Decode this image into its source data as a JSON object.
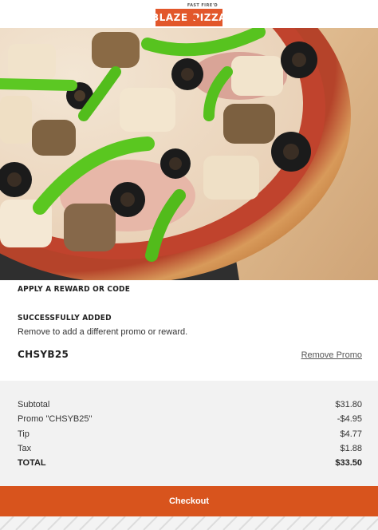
{
  "header": {
    "logo_tagline": "FAST FIRE'D",
    "logo_left": "BLAZE",
    "logo_right": "PIZZA"
  },
  "promo": {
    "heading": "APPLY A REWARD OR CODE",
    "status_heading": "SUCCESSFULLY ADDED",
    "status_body": "Remove to add a different promo or reward.",
    "code": "CHSYB25",
    "remove_label": "Remove Promo"
  },
  "totals": {
    "rows": [
      {
        "label": "Subtotal",
        "value": "$31.80"
      },
      {
        "label": "Promo \"CHSYB25\"",
        "value": "-$4.95"
      },
      {
        "label": "Tip",
        "value": "$4.77"
      },
      {
        "label": "Tax",
        "value": "$1.88"
      }
    ],
    "total_label": "TOTAL",
    "total_value": "$33.50"
  },
  "checkout": {
    "label": "Checkout"
  },
  "colors": {
    "brand": "#e2572b",
    "checkout_button": "#d8541d"
  }
}
